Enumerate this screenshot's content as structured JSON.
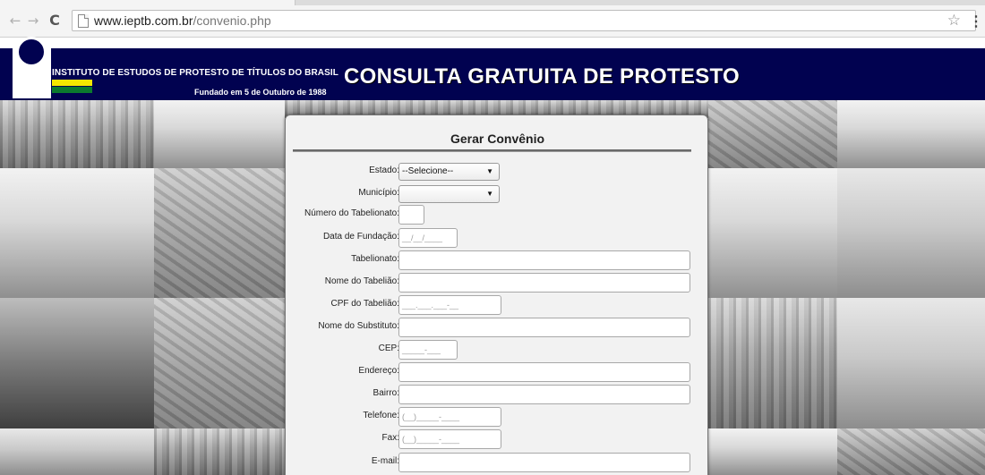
{
  "browser": {
    "url_host": "www.ieptb.com.br",
    "url_path": "/convenio.php"
  },
  "banner": {
    "institute_name": "INSTITUTO DE ESTUDOS DE PROTESTO DE TÍTULOS DO BRASIL",
    "founded": "Fundado em 5 de Outubro de 1988",
    "title": "CONSULTA GRATUITA DE PROTESTO"
  },
  "form": {
    "title": "Gerar Convênio",
    "fields": [
      {
        "label": "Estado:",
        "value": "--Selecione--"
      },
      {
        "label": "Município:",
        "value": ""
      },
      {
        "label": "Número do Tabelionato:",
        "value": ""
      },
      {
        "label": "Data de Fundação:",
        "value": "__/__/____"
      },
      {
        "label": "Tabelionato:",
        "value": ""
      },
      {
        "label": "Nome do Tabelião:",
        "value": ""
      },
      {
        "label": "CPF do Tabelião:",
        "value": "___.___.___-__"
      },
      {
        "label": "Nome do Substituto:",
        "value": ""
      },
      {
        "label": "CEP:",
        "value": "_____-___"
      },
      {
        "label": "Endereço:",
        "value": ""
      },
      {
        "label": "Bairro:",
        "value": ""
      },
      {
        "label": "Telefone:",
        "value": "(__)_____-____"
      },
      {
        "label": "Fax:",
        "value": "(__)_____-____"
      },
      {
        "label": "E-mail:",
        "value": ""
      }
    ]
  }
}
